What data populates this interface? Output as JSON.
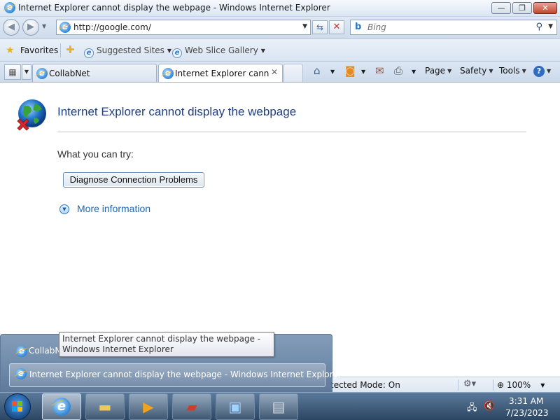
{
  "window": {
    "title": "Internet Explorer cannot display the webpage - Windows Internet Explorer",
    "minimize": "—",
    "maximize": "❐",
    "close": "✕"
  },
  "navbar": {
    "back": "◀",
    "forward": "▶",
    "url": "http://google.com/",
    "search_placeholder": "Bing",
    "refresh": "⇆",
    "stop": "✕"
  },
  "favorites_bar": {
    "favorites_label": "Favorites",
    "links": [
      {
        "label": "Suggested Sites"
      },
      {
        "label": "Web Slice Gallery"
      }
    ]
  },
  "tabs": [
    {
      "label": "CollabNet"
    },
    {
      "label": "Internet Explorer canno..."
    }
  ],
  "command_bar": {
    "page": "Page",
    "safety": "Safety",
    "tools": "Tools",
    "help": "?"
  },
  "error_page": {
    "title": "Internet Explorer cannot display the webpage",
    "try_label": "What you can try:",
    "diagnose_button": "Diagnose Connection Problems",
    "more_info": "More information"
  },
  "status_bar": {
    "mode_text": "tected Mode: On",
    "zoom": "100%"
  },
  "taskbar_popup": {
    "tooltip": "Internet Explorer cannot display the webpage - Windows Internet Explorer",
    "items": [
      {
        "label": "CollabNet"
      },
      {
        "label": "Internet Explorer cannot display the webpage - Windows Internet Explorer"
      }
    ]
  },
  "tray": {
    "time": "3:31 AM",
    "date": "7/23/2023"
  },
  "colors": {
    "error_title": "#1f3f84",
    "link": "#2268b2",
    "taskbar": "#2c4662"
  }
}
